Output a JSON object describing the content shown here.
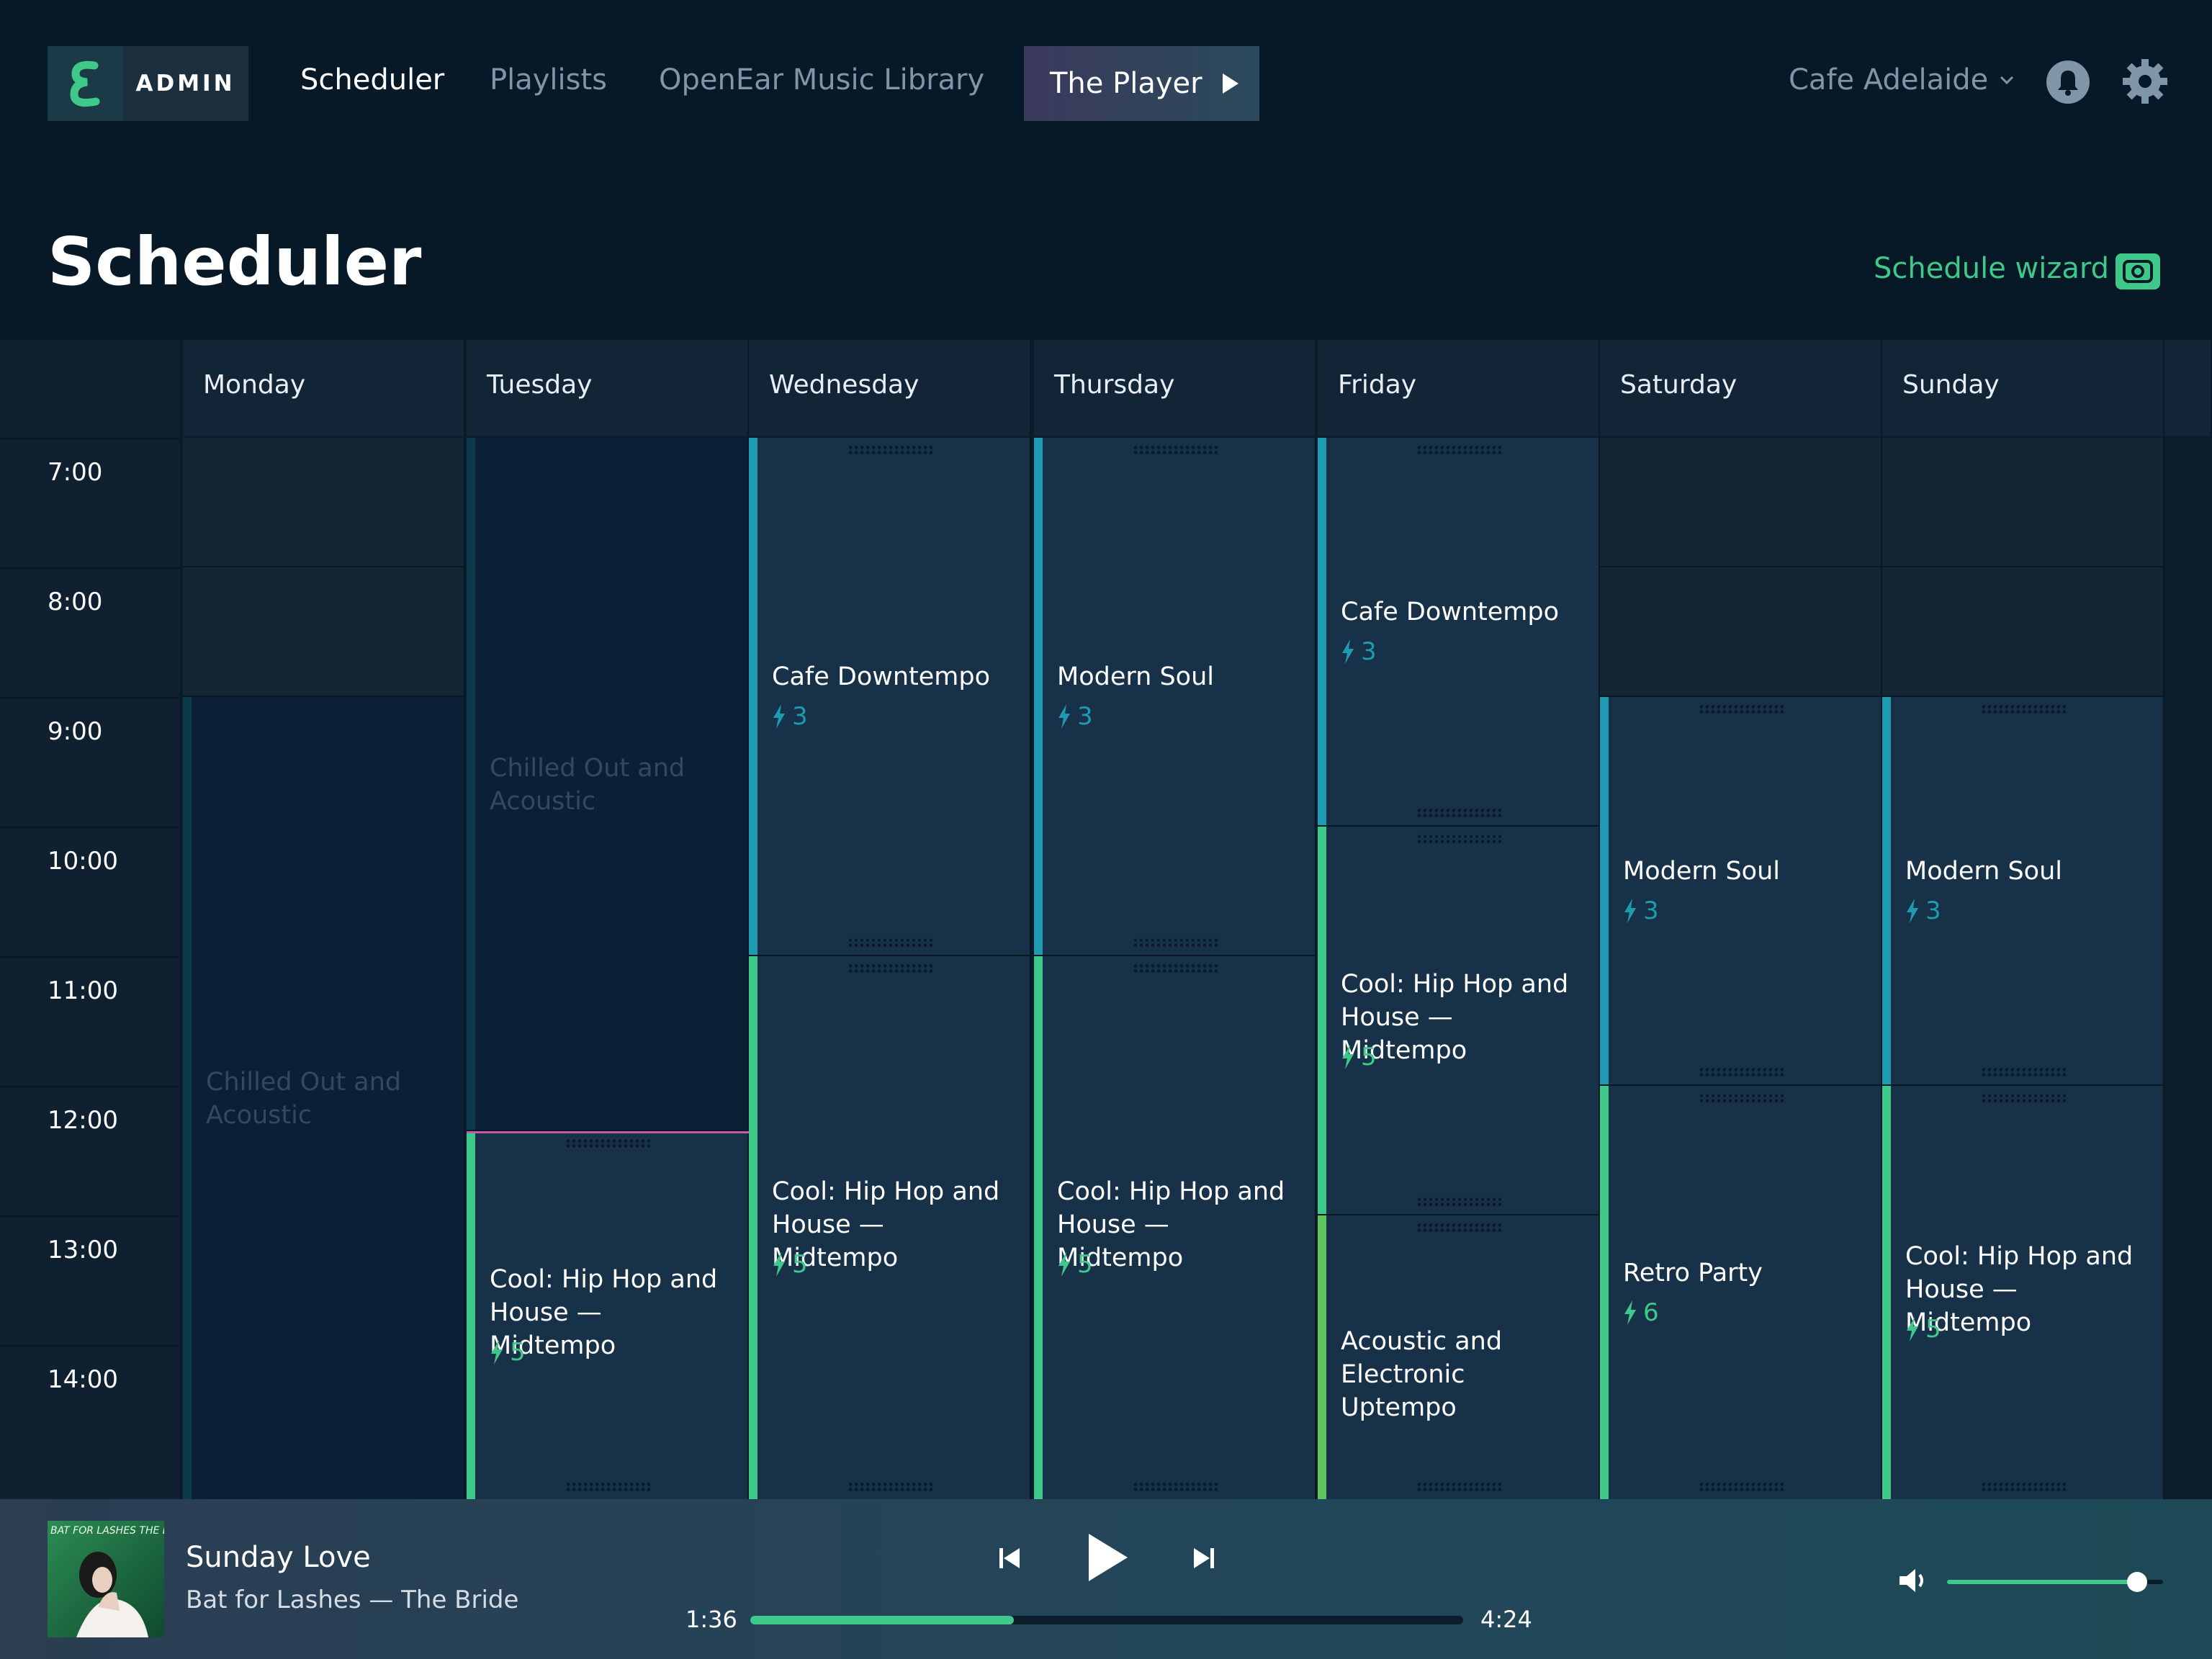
{
  "nav": {
    "admin_label": "ADMIN",
    "links": [
      "Scheduler",
      "Playlists",
      "OpenEar Music Library"
    ],
    "player_button": "The Player",
    "venue": "Cafe Adelaide"
  },
  "page": {
    "title": "Scheduler",
    "wizard_label": "Schedule wizard"
  },
  "days": [
    "Monday",
    "Tuesday",
    "Wednesday",
    "Thursday",
    "Friday",
    "Saturday",
    "Sunday"
  ],
  "hours": [
    "7:00",
    "8:00",
    "9:00",
    "10:00",
    "11:00",
    "12:00",
    "13:00",
    "14:00"
  ],
  "blocks": [
    {
      "day": 0,
      "start": 9,
      "end": 15.2,
      "title": "Chilled Out and Acoustic",
      "energy": "",
      "dim": true,
      "color": "#0d3a4a"
    },
    {
      "day": 1,
      "start": 7,
      "end": 12.35,
      "title": "Chilled Out and Acoustic",
      "energy": "",
      "dim": true,
      "color": "#0d3a4a"
    },
    {
      "day": 1,
      "start": 12.35,
      "end": 15.2,
      "title": "Cool: Hip Hop and House — Midtempo",
      "energy": "5",
      "dim": false,
      "color": "#3ec88a"
    },
    {
      "day": 2,
      "start": 7,
      "end": 11,
      "title": "Cafe Downtempo",
      "energy": "3",
      "dim": false,
      "color": "#1e9bb0"
    },
    {
      "day": 2,
      "start": 11,
      "end": 15.2,
      "title": "Cool: Hip Hop and House — Midtempo",
      "energy": "5",
      "dim": false,
      "color": "#3ec88a"
    },
    {
      "day": 3,
      "start": 7,
      "end": 11,
      "title": "Modern Soul",
      "energy": "3",
      "dim": false,
      "color": "#1e9bb0"
    },
    {
      "day": 3,
      "start": 11,
      "end": 15.2,
      "title": "Cool: Hip Hop and House — Midtempo",
      "energy": "5",
      "dim": false,
      "color": "#3ec88a"
    },
    {
      "day": 4,
      "start": 7,
      "end": 10,
      "title": "Cafe Downtempo",
      "energy": "3",
      "dim": false,
      "color": "#1e9bb0"
    },
    {
      "day": 4,
      "start": 10,
      "end": 13,
      "title": "Cool: Hip Hop and House — Midtempo",
      "energy": "5",
      "dim": false,
      "color": "#3ec88a"
    },
    {
      "day": 4,
      "start": 13,
      "end": 15.2,
      "title": "Acoustic and Electronic Uptempo",
      "energy": "",
      "dim": false,
      "color": "#5bc45a"
    },
    {
      "day": 5,
      "start": 9,
      "end": 12,
      "title": "Modern Soul",
      "energy": "3",
      "dim": false,
      "color": "#1e9bb0"
    },
    {
      "day": 5,
      "start": 12,
      "end": 15.2,
      "title": "Retro Party",
      "energy": "6",
      "dim": false,
      "color": "#3ec88a"
    },
    {
      "day": 6,
      "start": 9,
      "end": 12,
      "title": "Modern Soul",
      "energy": "3",
      "dim": false,
      "color": "#1e9bb0"
    },
    {
      "day": 6,
      "start": 12,
      "end": 15.2,
      "title": "Cool: Hip Hop and House — Midtempo",
      "energy": "5",
      "dim": false,
      "color": "#3ec88a"
    }
  ],
  "player": {
    "album_text": "BAT FOR LASHES THE BRIDE",
    "track": "Sunday Love",
    "artist": "Bat for Lashes — The Bride",
    "current_time": "1:36",
    "total_time": "4:24",
    "progress": 0.37,
    "volume": 0.88
  },
  "colors": {
    "accent": "#3ec88a",
    "teal": "#1e9bb0",
    "pink_line": "#c45aa8"
  },
  "icons": [
    "logo-icon",
    "play-arrow-icon",
    "chevron-down-icon",
    "bell-icon",
    "gear-icon",
    "wizard-icon",
    "bolt-icon",
    "skip-back-icon",
    "play-icon",
    "skip-forward-icon",
    "volume-icon"
  ]
}
